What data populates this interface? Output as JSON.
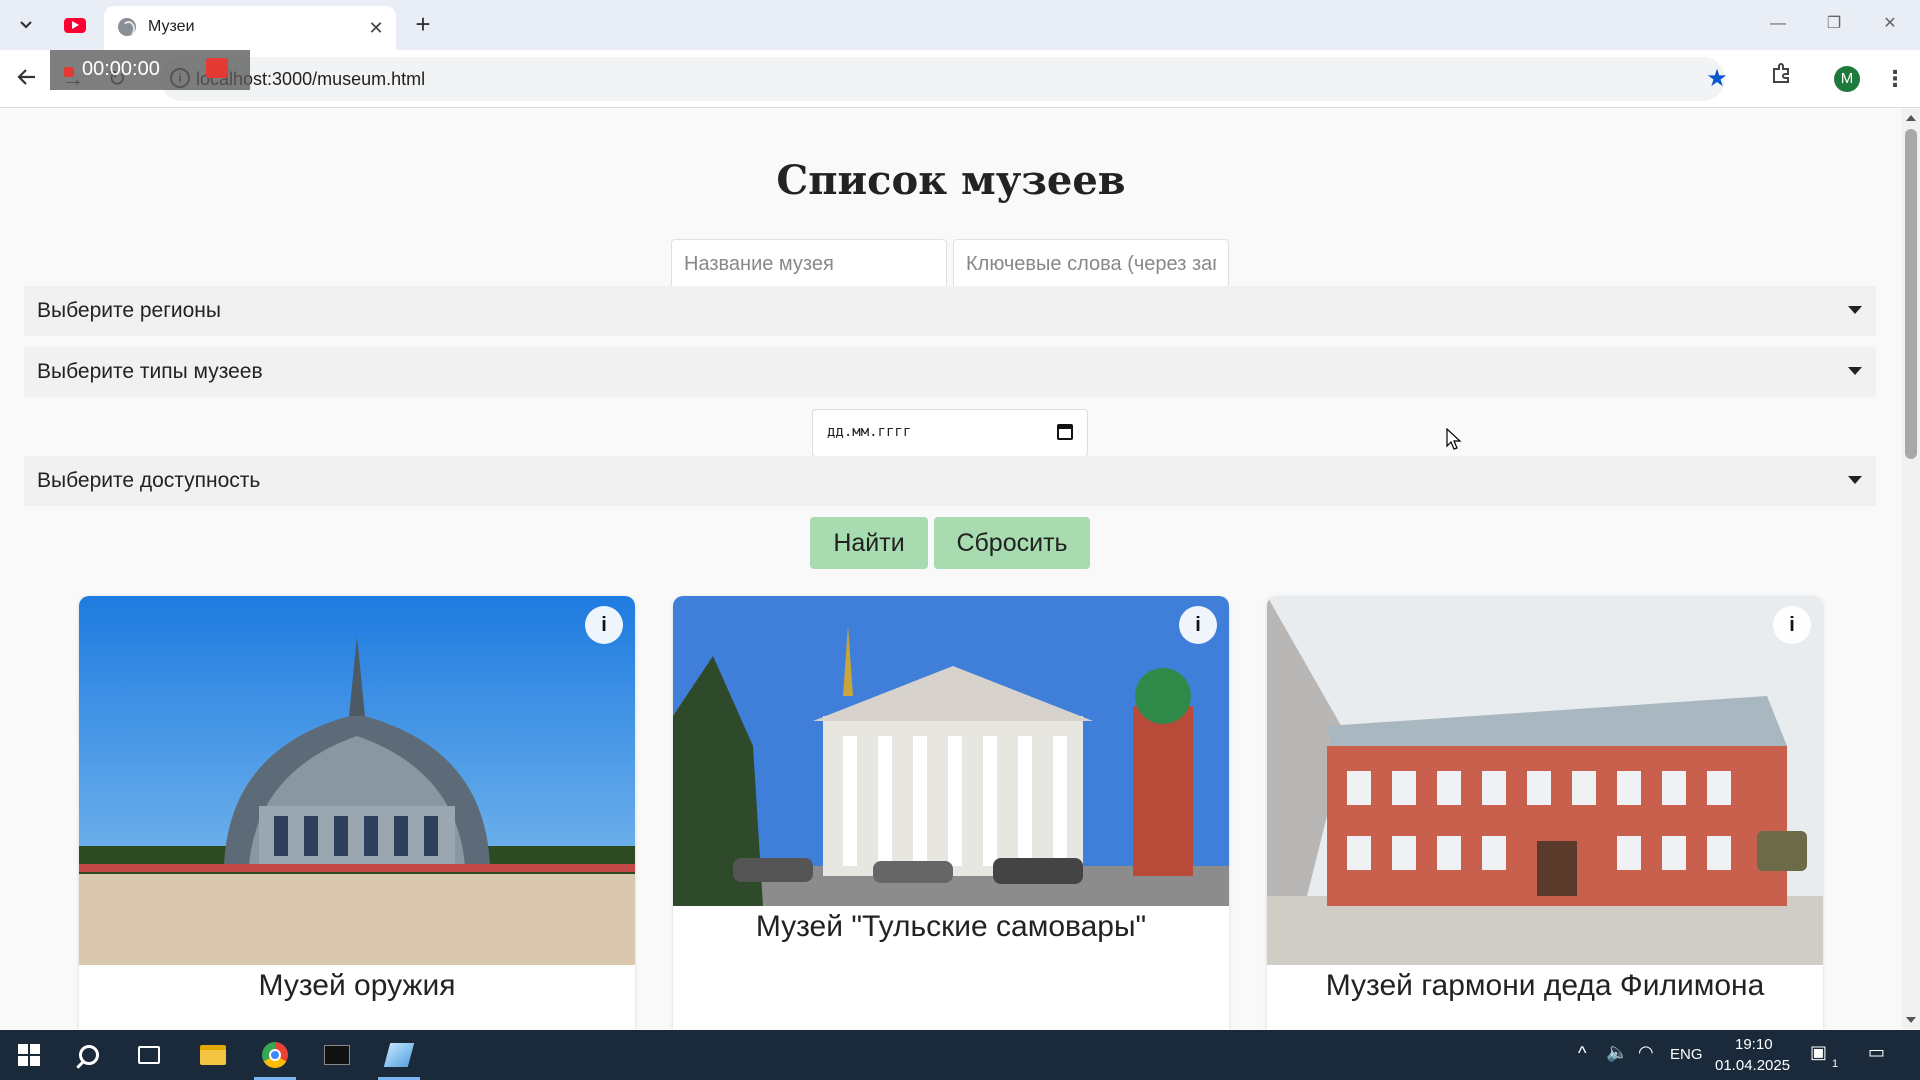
{
  "browser": {
    "active_tab_title": "Музеи",
    "url": "localhost:3000/museum.html",
    "profile_initial": "M",
    "recording_time": "00:00:00"
  },
  "page": {
    "title": "Список музеев",
    "name_input_placeholder": "Название музея",
    "keywords_input_placeholder": "Ключевые слова (через запятую)",
    "regions_select": "Выберите регионы",
    "types_select": "Выберите типы музеев",
    "date_placeholder": "дд.мм.гггг",
    "accessibility_select": "Выберите доступность",
    "search_button": "Найти",
    "reset_button": "Сбросить",
    "info_label": "i",
    "museums": [
      {
        "name": "Музей оружия"
      },
      {
        "name": "Музей \"Тульские самовары\""
      },
      {
        "name": "Музей гармони деда Филимона"
      }
    ]
  },
  "taskbar": {
    "language": "ENG",
    "time": "19:10",
    "date": "01.04.2025",
    "notification_count": "1"
  },
  "colors": {
    "button_green": "#a8dcb0",
    "select_bg": "#f1f1f1",
    "taskbar_bg": "#1a2a3a",
    "bookmark_star": "#0b57d0"
  }
}
